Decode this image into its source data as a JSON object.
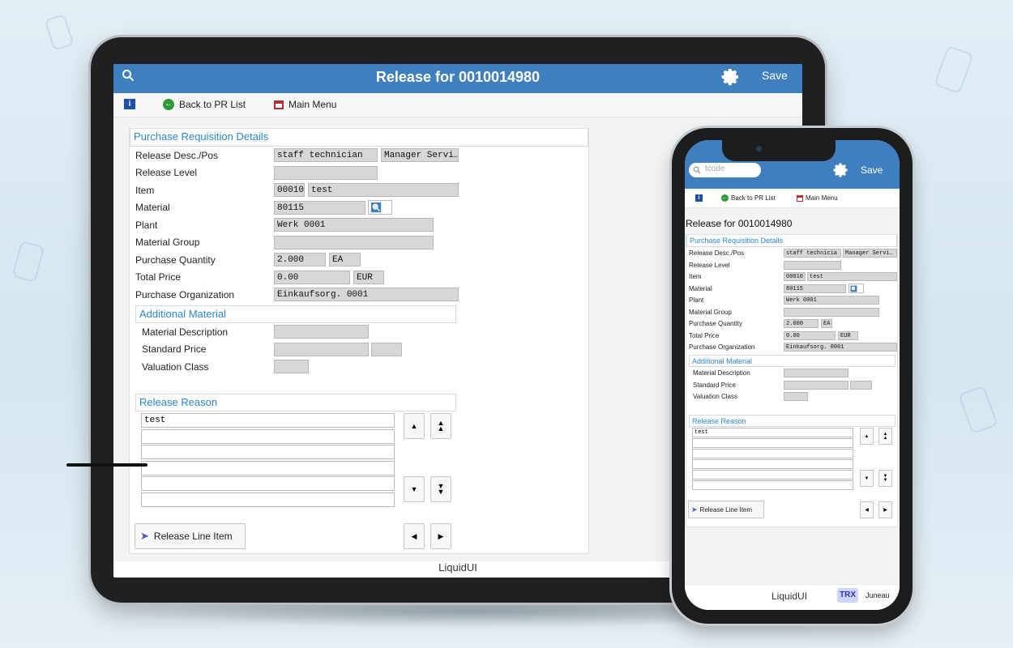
{
  "tablet": {
    "header": {
      "title": "Release for 0010014980",
      "save_label": "Save"
    },
    "toolbar": {
      "back_label": "Back to PR List",
      "main_menu_label": "Main Menu"
    },
    "groups": {
      "pr_details": "Purchase Requisition Details",
      "additional_material": "Additional Material",
      "release_reason": "Release Reason"
    },
    "fields": {
      "release_desc_label": "Release Desc./Pos",
      "release_desc_value1": "staff technician",
      "release_desc_value2": "Manager Servi…",
      "release_level_label": "Release Level",
      "item_label": "Item",
      "item_value1": "00010",
      "item_value2": "test",
      "material_label": "Material",
      "material_value": "80115",
      "plant_label": "Plant",
      "plant_value": "Werk 0001",
      "material_group_label": "Material Group",
      "purchase_qty_label": "Purchase Quantity",
      "purchase_qty_value": "2.000",
      "purchase_qty_unit": "EA",
      "total_price_label": "Total Price",
      "total_price_value": "0.00",
      "total_price_currency": "EUR",
      "purchase_org_label": "Purchase Organization",
      "purchase_org_value": "Einkaufsorg. 0001",
      "material_desc_label": "Material Description",
      "standard_price_label": "Standard Price",
      "valuation_class_label": "Valuation Class"
    },
    "release_reason_lines": [
      "test",
      "",
      "",
      "",
      "",
      ""
    ],
    "release_line_item_label": "Release Line Item",
    "footer": "LiquidUI"
  },
  "phone": {
    "header": {
      "tcode_placeholder": "tcode",
      "save_label": "Save"
    },
    "toolbar": {
      "back_label": "Back to PR List",
      "main_menu_label": "Main Menu"
    },
    "title": "Release for 0010014980",
    "groups": {
      "pr_details": "Purchase Requisition Details",
      "additional_material": "Additional Material",
      "release_reason": "Release Reason"
    },
    "fields": {
      "release_desc_label": "Release Desc./Pos",
      "release_desc_value1": "staff technicia",
      "release_desc_value2": "Manager Servi…",
      "release_level_label": "Release Level",
      "item_label": "Item",
      "item_value1": "00010",
      "item_value2": "test",
      "material_label": "Material",
      "material_value": "80115",
      "plant_label": "Plant",
      "plant_value": "Werk 0001",
      "material_group_label": "Material Group",
      "purchase_qty_label": "Purchase Quantity",
      "purchase_qty_value": "2.000",
      "purchase_qty_unit": "EA",
      "total_price_label": "Total Price",
      "total_price_value": "0.00",
      "total_price_currency": "EUR",
      "purchase_org_label": "Purchase Organization",
      "purchase_org_value": "Einkaufsorg. 0001",
      "material_desc_label": "Material Description",
      "standard_price_label": "Standard Price",
      "valuation_class_label": "Valuation Class"
    },
    "release_reason_lines": [
      "test",
      "",
      "",
      "",
      "",
      ""
    ],
    "release_line_item_label": "Release Line Item",
    "footer": {
      "brand": "LiquidUI",
      "trx_badge": "TRX",
      "user": "Juneau"
    }
  },
  "colors": {
    "header_blue": "#3f7fbf",
    "group_title_blue": "#2b86cf",
    "field_gray": "#d6d7d8"
  }
}
